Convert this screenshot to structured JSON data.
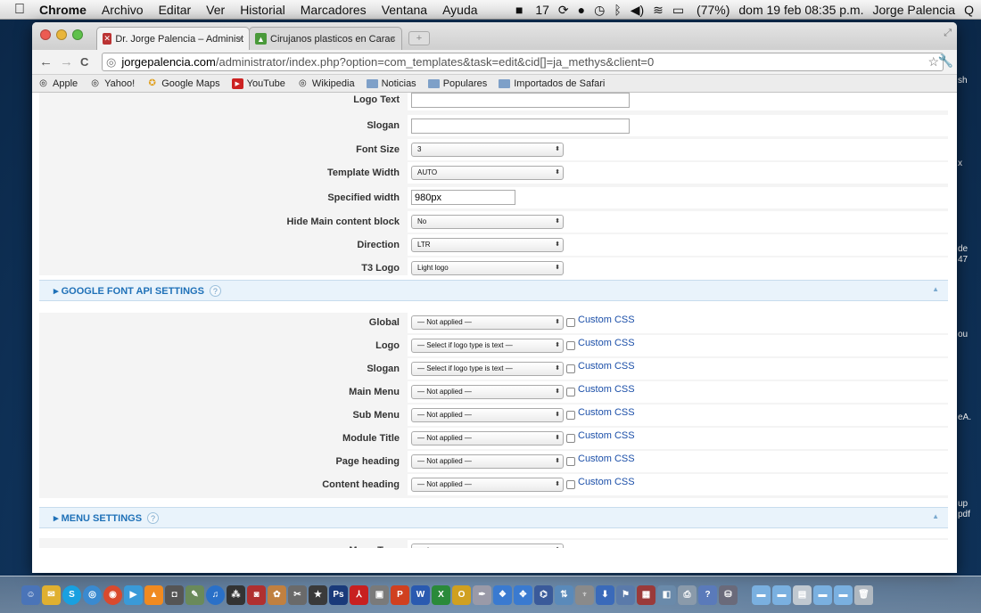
{
  "menubar": {
    "apple": "",
    "app": "Chrome",
    "items": [
      "Archivo",
      "Editar",
      "Ver",
      "Historial",
      "Marcadores",
      "Ventana",
      "Ayuda"
    ],
    "status": {
      "adobe": "17",
      "battery": "(77%)",
      "datetime": "dom 19 feb  08:35 p.m.",
      "user": "Jorge Palencia",
      "search": "Q"
    }
  },
  "tabs": [
    {
      "title": "Dr. Jorge Palencia – Administ",
      "close": "×"
    },
    {
      "title": "Cirujanos plasticos en Carac",
      "close": "×"
    }
  ],
  "toolbar": {
    "back": "←",
    "forward": "→",
    "reload": "C",
    "url_domain": "jorgepalencia.com",
    "url_rest": "/administrator/index.php?option=com_templates&task=edit&cid[]=ja_methys&client=0",
    "star": "☆",
    "wrench": "🔧"
  },
  "bookmarks": [
    "Apple",
    "Yahoo!",
    "Google Maps",
    "YouTube",
    "Wikipedia",
    "Noticias",
    "Populares",
    "Importados de Safari"
  ],
  "general": {
    "logo_text": {
      "label": "Logo Text",
      "value": ""
    },
    "slogan": {
      "label": "Slogan",
      "value": ""
    },
    "font_size": {
      "label": "Font Size",
      "value": "3"
    },
    "template_width": {
      "label": "Template Width",
      "value": "AUTO"
    },
    "specified_width": {
      "label": "Specified width",
      "value": "980px"
    },
    "hide_main": {
      "label": "Hide Main content block",
      "value": "No"
    },
    "direction": {
      "label": "Direction",
      "value": "LTR"
    },
    "t3_logo": {
      "label": "T3 Logo",
      "value": "Light logo"
    }
  },
  "google_font": {
    "title": "GOOGLE FONT API SETTINGS",
    "help": "?",
    "collapse": "▲",
    "custom_css": "Custom CSS",
    "rows": [
      {
        "label": "Global",
        "value": "— Not applied —"
      },
      {
        "label": "Logo",
        "value": "— Select if logo type is text —"
      },
      {
        "label": "Slogan",
        "value": "— Select if logo type is text —"
      },
      {
        "label": "Main Menu",
        "value": "— Not applied —"
      },
      {
        "label": "Sub Menu",
        "value": "— Not applied —"
      },
      {
        "label": "Module Title",
        "value": "— Not applied —"
      },
      {
        "label": "Page heading",
        "value": "— Not applied —"
      },
      {
        "label": "Content heading",
        "value": "— Not applied —"
      }
    ]
  },
  "menu_settings": {
    "title": "MENU SETTINGS",
    "help": "?",
    "collapse": "▲",
    "menu_type": {
      "label": "Menu Type",
      "value": "mainmenu"
    }
  },
  "desktop_labels": [
    "sh",
    "x",
    "de",
    "47",
    "ou",
    "eA.",
    "up",
    "pdf"
  ],
  "icons": {
    "select_arrow": "⬍",
    "section_arrow": "▸"
  }
}
